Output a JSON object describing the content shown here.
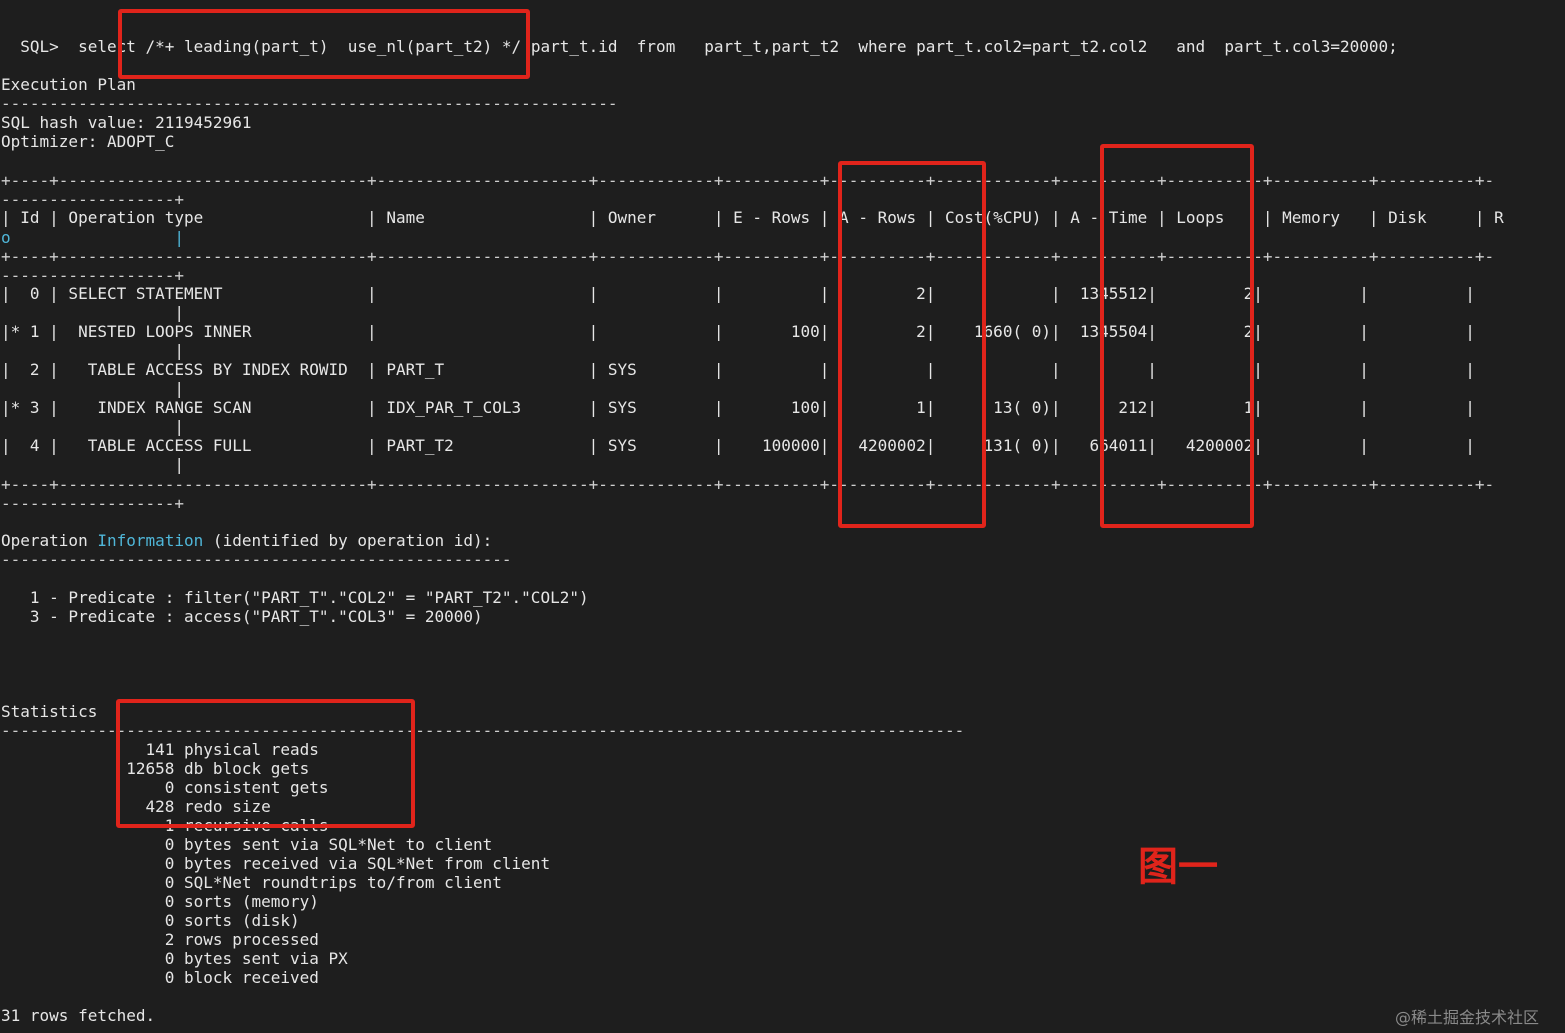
{
  "sql": {
    "prompt": "SQL>",
    "select_kw": "select",
    "hint": "/*+ leading(part_t)  use_nl(part_t2) */",
    "rest": "part_t.id  from   part_t,part_t2  where part_t.col2=part_t2.col2   and  part_t.col3=20000;"
  },
  "plan": {
    "heading": "Execution Plan",
    "separator": "----------------------------------------------------------------",
    "hash": "SQL hash value: 2119452961",
    "optimizer": "Optimizer: ADOPT_C",
    "border_top": "+----+--------------------------------+----------------------+------------+----------+----------+------------+----------+----------+----------+----------+-",
    "border_tail": "------------------+",
    "header": "| Id | Operation type                 | Name                 | Owner      | E - Rows | A - Rows | Cost(%CPU) | A - Time | Loops    | Memory   | Disk     | R",
    "header_wrap": "o                 |",
    "rows": [
      {
        "line": "|  0 | SELECT STATEMENT               |                      |            |          |         2|            |  1345512|         2|          |          |",
        "wrap": "                  |"
      },
      {
        "line": "|* 1 |  NESTED LOOPS INNER            |                      |            |       100|         2|    1660( 0)|  1345504|         2|          |          |",
        "wrap": "                  |"
      },
      {
        "line": "|  2 |   TABLE ACCESS BY INDEX ROWID  | PART_T               | SYS        |          |          |            |         |          |          |          |",
        "wrap": "                  |"
      },
      {
        "line": "|* 3 |    INDEX RANGE SCAN            | IDX_PAR_T_COL3       | SYS        |       100|         1|      13( 0)|      212|         1|          |          |",
        "wrap": "                  |"
      },
      {
        "line": "|  4 |   TABLE ACCESS FULL            | PART_T2              | SYS        |    100000|   4200002|     131( 0)|   664011|   4200002|          |          |",
        "wrap": "                  |"
      }
    ]
  },
  "opinfo": {
    "label_start": "Operation ",
    "label_hl": "Information",
    "label_end": " (identified by operation id):",
    "separator": "-----------------------------------------------------",
    "predicates": [
      "   1 - Predicate : filter(\"PART_T\".\"COL2\" = \"PART_T2\".\"COL2\")",
      "   3 - Predicate : access(\"PART_T\".\"COL3\" = 20000)"
    ]
  },
  "stats": {
    "heading": "Statistics",
    "separator": "----------------------------------------------------------------------------------------------------",
    "items": [
      "               141 physical reads",
      "             12658 db block gets",
      "                 0 consistent gets",
      "               428 redo size",
      "                 1 recursive calls",
      "                 0 bytes sent via SQL*Net to client",
      "                 0 bytes received via SQL*Net from client",
      "                 0 SQL*Net roundtrips to/from client",
      "                 0 sorts (memory)",
      "                 0 sorts (disk)",
      "                 2 rows processed",
      "                 0 bytes sent via PX",
      "                 0 block received"
    ]
  },
  "footer": "31 rows fetched.",
  "annotation": "图一",
  "watermark": "@稀土掘金技术社区",
  "colors": {
    "background": "#1e1e1e",
    "text": "#e6e6e6",
    "highlight_box": "#e0241b",
    "keyword": "#4fb6d8"
  }
}
